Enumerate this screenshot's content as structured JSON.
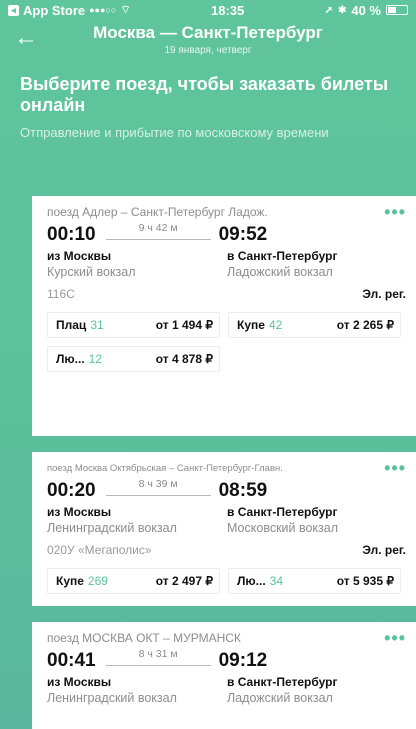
{
  "status_bar": {
    "app_store": "App Store",
    "signal": "●●●○○",
    "time": "18:35",
    "battery": "40 %"
  },
  "nav": {
    "title": "Москва — Санкт-Петербург",
    "subtitle": "19 января, четверг"
  },
  "intro": {
    "heading": "Выберите поезд, чтобы заказать билеты онлайн",
    "note": "Отправление и прибытие по московскому времени"
  },
  "trains": [
    {
      "name": "поезд Адлер – Санкт-Петербург Ладож.",
      "depart": "00:10",
      "duration": "9 ч 42 м",
      "arrive": "09:52",
      "from_label": "из Москвы",
      "from_station": "Курский вокзал",
      "to_label": "в Санкт-Петербург",
      "to_station": "Ладожский вокзал",
      "number": "116С",
      "reg": "Эл. рег.",
      "seats": [
        {
          "type": "Плац",
          "count": "31",
          "price": "от 1 494 ₽"
        },
        {
          "type": "Купе",
          "count": "42",
          "price": "от 2 265 ₽"
        },
        {
          "type": "Лю...",
          "count": "12",
          "price": "от 4 878 ₽"
        }
      ]
    },
    {
      "name": "поезд Москва Октябрьская – Санкт-Петербург-Главн.",
      "depart": "00:20",
      "duration": "8 ч 39 м",
      "arrive": "08:59",
      "from_label": "из Москвы",
      "from_station": "Ленинградский вокзал",
      "to_label": "в Санкт-Петербург",
      "to_station": "Московский вокзал",
      "number": "020У «Мегаполис»",
      "reg": "Эл. рег.",
      "seats": [
        {
          "type": "Купе",
          "count": "269",
          "price": "от 2 497 ₽"
        },
        {
          "type": "Лю...",
          "count": "34",
          "price": "от 5 935 ₽"
        }
      ]
    },
    {
      "name": "поезд МОСКВА ОКТ – МУРМАНСК",
      "depart": "00:41",
      "duration": "8 ч 31 м",
      "arrive": "09:12",
      "from_label": "из Москвы",
      "from_station": "Ленинградский вокзал",
      "to_label": "в Санкт-Петербург",
      "to_station": "Ладожский вокзал"
    }
  ],
  "colors": {
    "accent": "#5bc49b",
    "background": "#5fc59c"
  }
}
